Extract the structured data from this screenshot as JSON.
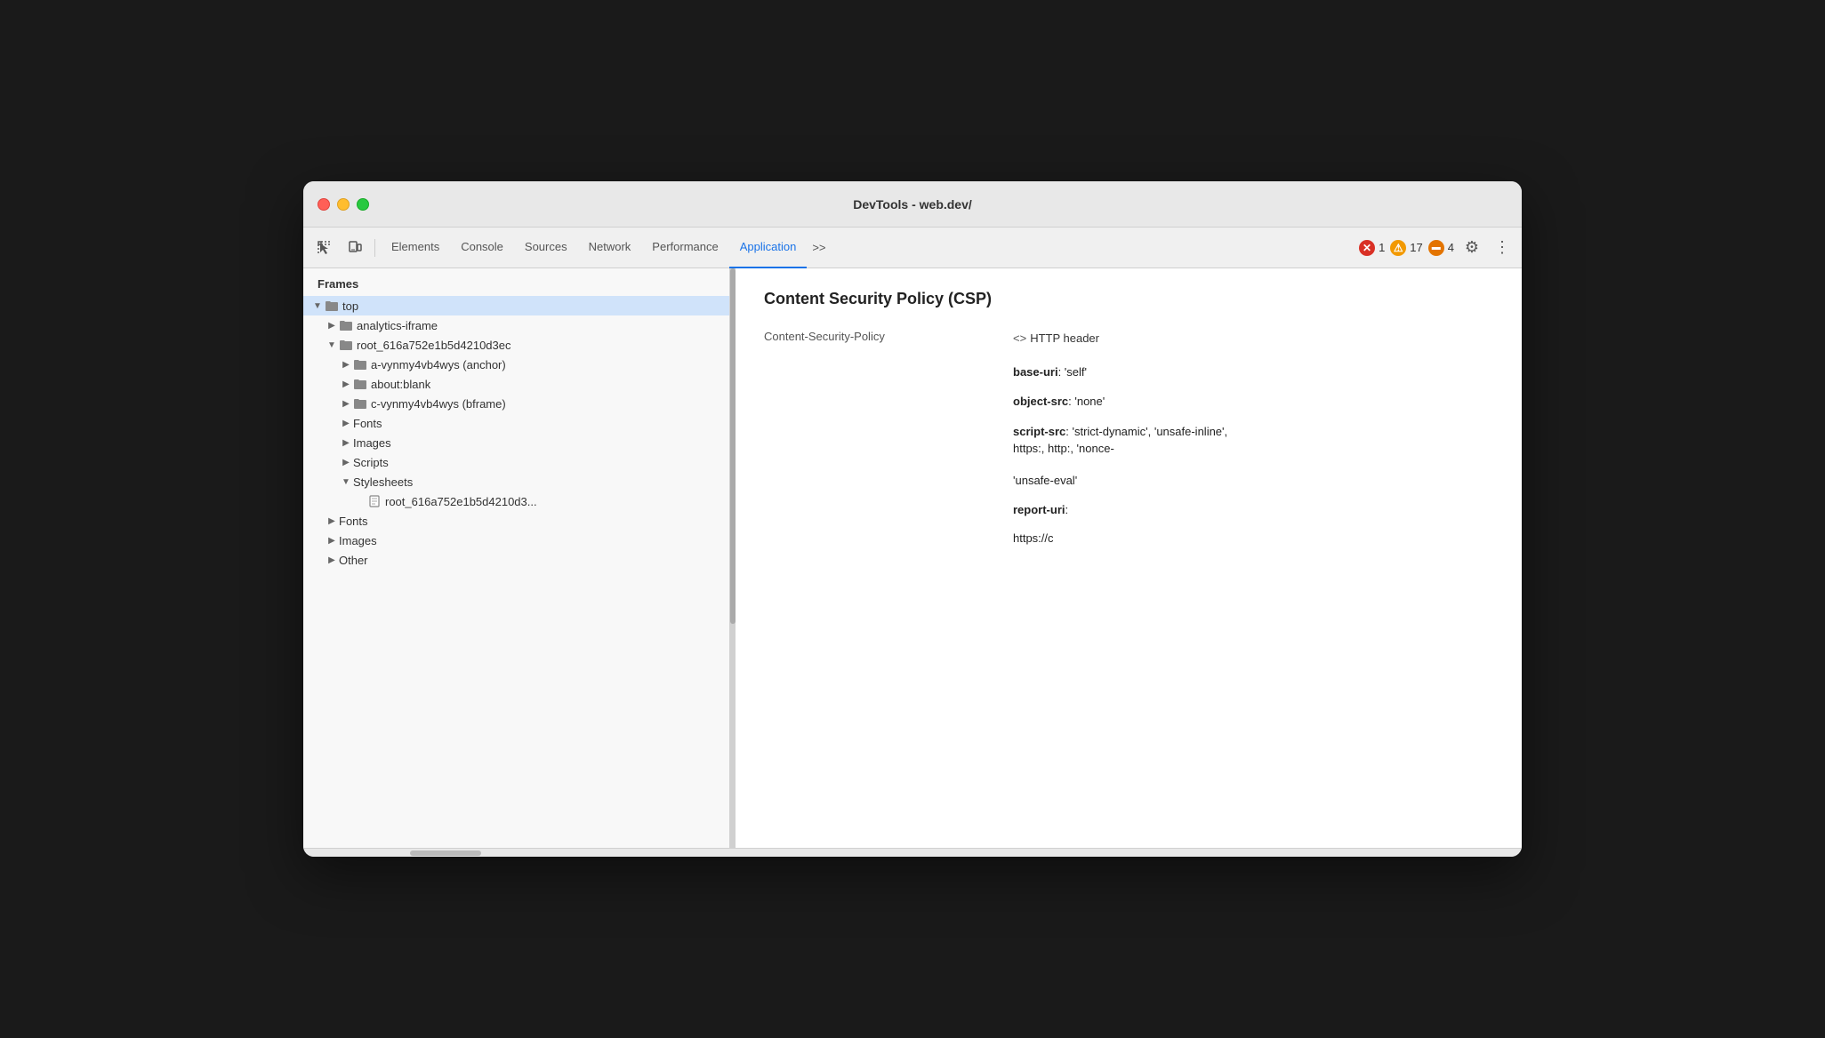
{
  "window": {
    "title": "DevTools - web.dev/"
  },
  "toolbar": {
    "icons": [
      "selector-icon",
      "device-icon"
    ],
    "tabs": [
      {
        "label": "Elements",
        "id": "elements",
        "active": false
      },
      {
        "label": "Console",
        "id": "console",
        "active": false
      },
      {
        "label": "Sources",
        "id": "sources",
        "active": false
      },
      {
        "label": "Network",
        "id": "network",
        "active": false
      },
      {
        "label": "Performance",
        "id": "performance",
        "active": false
      },
      {
        "label": "Application",
        "id": "application",
        "active": true
      }
    ],
    "overflow_label": ">>",
    "error_count": "1",
    "warning_count": "17",
    "info_count": "4"
  },
  "sidebar": {
    "header": "Frames",
    "items": [
      {
        "id": "top",
        "label": "top",
        "type": "folder",
        "level": 0,
        "open": true,
        "selected": false
      },
      {
        "id": "analytics-iframe",
        "label": "analytics-iframe",
        "type": "folder",
        "level": 1,
        "open": false,
        "selected": false
      },
      {
        "id": "root_616a752e1b5d4210d3ec",
        "label": "root_616a752e1b5d4210d3ec",
        "type": "folder",
        "level": 1,
        "open": true,
        "selected": false
      },
      {
        "id": "a-vynmy4vb4wys",
        "label": "a-vynmy4vb4wys (anchor)",
        "type": "folder",
        "level": 2,
        "open": false,
        "selected": false
      },
      {
        "id": "about-blank",
        "label": "about:blank",
        "type": "folder",
        "level": 2,
        "open": false,
        "selected": false
      },
      {
        "id": "c-vynmy4vb4wys",
        "label": "c-vynmy4vb4wys (bframe)",
        "type": "folder",
        "level": 2,
        "open": false,
        "selected": false
      },
      {
        "id": "fonts-inner",
        "label": "Fonts",
        "type": "folder",
        "level": 2,
        "open": false,
        "selected": false
      },
      {
        "id": "images-inner",
        "label": "Images",
        "type": "folder",
        "level": 2,
        "open": false,
        "selected": false
      },
      {
        "id": "scripts-inner",
        "label": "Scripts",
        "type": "folder",
        "level": 2,
        "open": false,
        "selected": false
      },
      {
        "id": "stylesheets-inner",
        "label": "Stylesheets",
        "type": "folder",
        "level": 2,
        "open": true,
        "selected": false
      },
      {
        "id": "stylesheet-file",
        "label": "root_616a752e1b5d4210d3...",
        "type": "file",
        "level": 3,
        "open": false,
        "selected": false
      },
      {
        "id": "fonts-outer",
        "label": "Fonts",
        "type": "folder",
        "level": 1,
        "open": false,
        "selected": false
      },
      {
        "id": "images-outer",
        "label": "Images",
        "type": "folder",
        "level": 1,
        "open": false,
        "selected": false
      },
      {
        "id": "other-outer",
        "label": "Other",
        "type": "folder",
        "level": 1,
        "open": false,
        "selected": false
      }
    ]
  },
  "content": {
    "title": "Content Security Policy (CSP)",
    "csp_key": "Content-Security-Policy",
    "csp_source": "<> HTTP header",
    "directives": [
      {
        "key": "base-uri",
        "value": "'self'"
      },
      {
        "key": "object-src",
        "value": "'none'"
      },
      {
        "key": "script-src",
        "value": "'strict-dynamic', 'unsafe-inline',\nhttps:, http:, 'nonce-\n\n'unsafe-eval'"
      },
      {
        "key": "report-uri",
        "value": "https://c"
      }
    ]
  },
  "colors": {
    "active_tab": "#1a73e8",
    "selected_bg": "#d0e3fa",
    "error_red": "#d93025",
    "warning_yellow": "#f29900",
    "info_orange": "#e37400"
  }
}
